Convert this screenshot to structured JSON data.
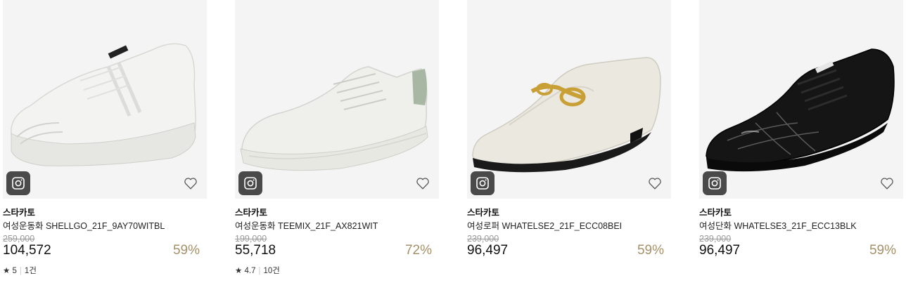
{
  "products": [
    {
      "brand": "스타카토",
      "name": "여성운동화 SHELLGO_21F_9AY70WITBL",
      "original_price": "259,000",
      "price": "104,572",
      "discount": "59%",
      "rating": "5",
      "reviews": "1건",
      "shoe_color": "#f2f2f0"
    },
    {
      "brand": "스타카토",
      "name": "여성운동화 TEEMIX_21F_AX821WIT",
      "original_price": "199,000",
      "price": "55,718",
      "discount": "72%",
      "rating": "4.7",
      "reviews": "10건",
      "shoe_color": "#eeeeea"
    },
    {
      "brand": "스타카토",
      "name": "여성로퍼 WHATELSE2_21F_ECC08BEI",
      "original_price": "239,000",
      "price": "96,497",
      "discount": "59%",
      "shoe_color": "#ebe8e0"
    },
    {
      "brand": "스타카토",
      "name": "여성단화 WHATELSE3_21F_ECC13BLK",
      "original_price": "239,000",
      "price": "96,497",
      "discount": "59%",
      "shoe_color": "#141414"
    }
  ],
  "icons": {
    "instagram": "instagram-icon",
    "wishlist": "heart-outline-icon",
    "star": "star-icon"
  },
  "colors": {
    "discount": "#a3916b",
    "image_bg": "#f4f4f4"
  }
}
